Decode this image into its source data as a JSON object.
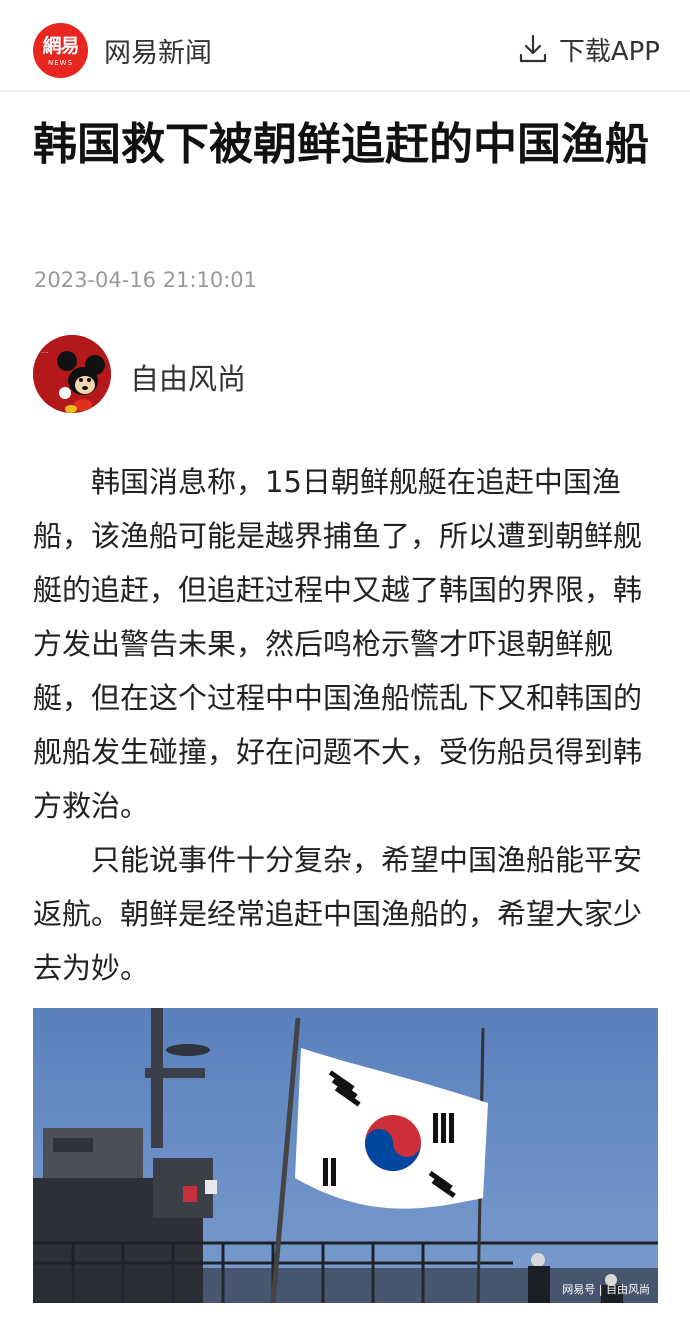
{
  "header": {
    "logo_main": "網易",
    "logo_sub": "NEWS",
    "brand_name": "网易新闻",
    "download_label": "下载APP",
    "download_icon": "download-icon"
  },
  "article": {
    "title": "韩国救下被朝鲜追赶的中国渔船",
    "timestamp": "2023-04-16 21:10:01",
    "author": "自由风尚",
    "paragraphs": [
      "韩国消息称，15日朝鲜舰艇在追赶中国渔船，该渔船可能是越界捕鱼了，所以遭到朝鲜舰艇的追赶，但追赶过程中又越了韩国的界限，韩方发出警告未果，然后鸣枪示警才吓退朝鲜舰艇，但在这个过程中中国渔船慌乱下又和韩国的舰船发生碰撞，好在问题不大，受伤船员得到韩方救治。",
      "只能说事件十分复杂，希望中国渔船能平安返航。朝鲜是经常追赶中国渔船的，希望大家少去为妙。"
    ],
    "image_watermark": "网易号 | 自由风尚"
  },
  "colors": {
    "brand_red": "#e8251e",
    "timestamp_gray": "#999999",
    "sky_blue": "#5b83c0"
  }
}
